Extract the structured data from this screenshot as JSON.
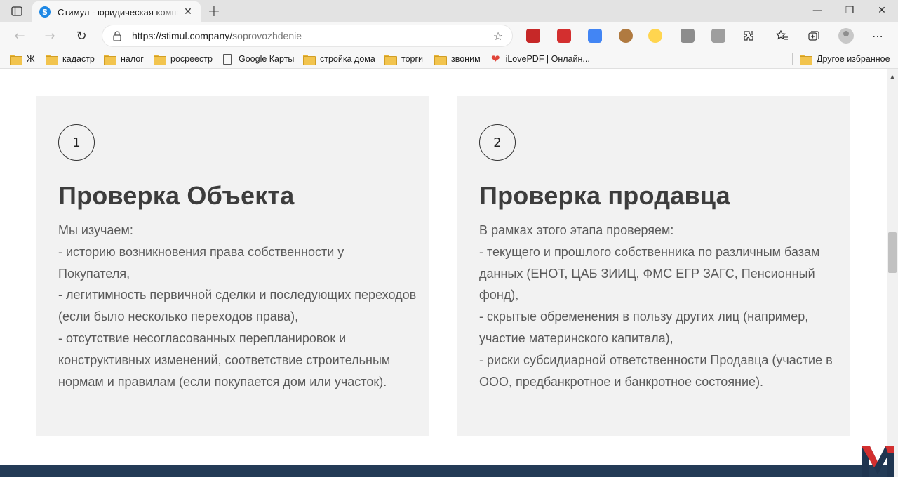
{
  "browser": {
    "tab": {
      "favicon_letter": "S",
      "title": "Стимул - юридическая компания",
      "close": "✕"
    },
    "new_tab": "+",
    "window": {
      "minimize": "—",
      "maximize": "❐",
      "close": "✕"
    },
    "nav": {
      "back": "←",
      "forward": "→",
      "reload": "↻"
    },
    "url": {
      "host": "https://stimul.company/",
      "path": "soprovozhdenie"
    },
    "fav_add": "☆",
    "menu": "⋯",
    "bookmarks": [
      {
        "label": "Ж",
        "type": "folder"
      },
      {
        "label": "кадастр",
        "type": "folder"
      },
      {
        "label": "налог",
        "type": "folder"
      },
      {
        "label": "росреестр",
        "type": "folder"
      },
      {
        "label": "Google Карты",
        "type": "page"
      },
      {
        "label": "стройка дома",
        "type": "folder"
      },
      {
        "label": "торги",
        "type": "folder"
      },
      {
        "label": "звоним",
        "type": "folder"
      },
      {
        "label": "iLovePDF | Онлайн...",
        "type": "heart"
      }
    ],
    "other_bookmarks": "Другое избранное"
  },
  "cards": [
    {
      "number": "1",
      "title": "Проверка Объекта",
      "lines": [
        "Мы изучаем:",
        "- историю возникновения права собственности у",
        "Покупателя,",
        "- легитимность первичной сделки и последующих переходов",
        "(если было несколько переходов права),",
        "- отсутствие несогласованных перепланировок и",
        "конструктивных изменений, соответствие строительным",
        "нормам и правилам (если покупается дом или участок)."
      ]
    },
    {
      "number": "2",
      "title": "Проверка продавца",
      "lines": [
        "В рамках этого этапа проверяем:",
        "- текущего и прошлого собственника по различным базам",
        "данных (ЕНОТ, ЦАБ ЗИИЦ, ФМС ЕГР ЗАГС, Пенсионный",
        "фонд),",
        "- скрытые обременения в пользу других лиц (например,",
        "участие материнского капитала),",
        "- риски субсидиарной ответственности Продавца (участие в",
        "ООО, предбанкротное и банкротное состояние)."
      ]
    }
  ],
  "colors": {
    "card_bg": "#f2f2f2",
    "title": "#3d3d3d",
    "body_text": "#5a5a5a",
    "footer_band": "#233b56",
    "logo_red": "#d32f2f",
    "logo_navy": "#1f3550"
  }
}
